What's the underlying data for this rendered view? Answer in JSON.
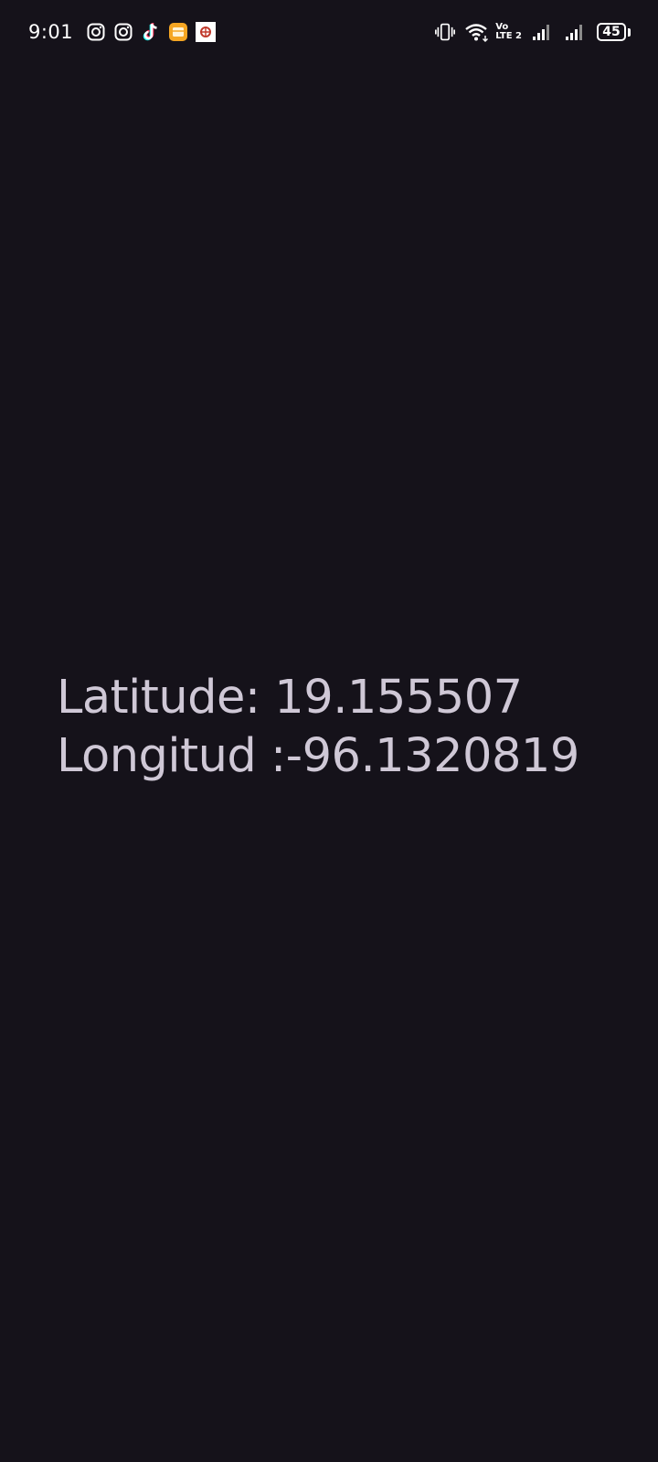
{
  "status_bar": {
    "time": "9:01",
    "notification_icons": [
      "instagram-icon",
      "instagram-icon",
      "tiktok-icon",
      "mail-app-icon",
      "app-icon"
    ],
    "vibrate_icon": "vibrate-icon",
    "wifi_icon": "wifi-icon",
    "volte_top": "Vo",
    "volte_bottom": "LTE 2",
    "signal_icons": [
      "signal-icon",
      "signal-icon"
    ],
    "battery_level": "45"
  },
  "location": {
    "latitude_line": "Latitude: 19.155507",
    "longitude_line": "Longitud :-96.1320819"
  },
  "colors": {
    "background": "#15121a",
    "text": "#cfc8d6",
    "status_text": "#ffffff"
  }
}
